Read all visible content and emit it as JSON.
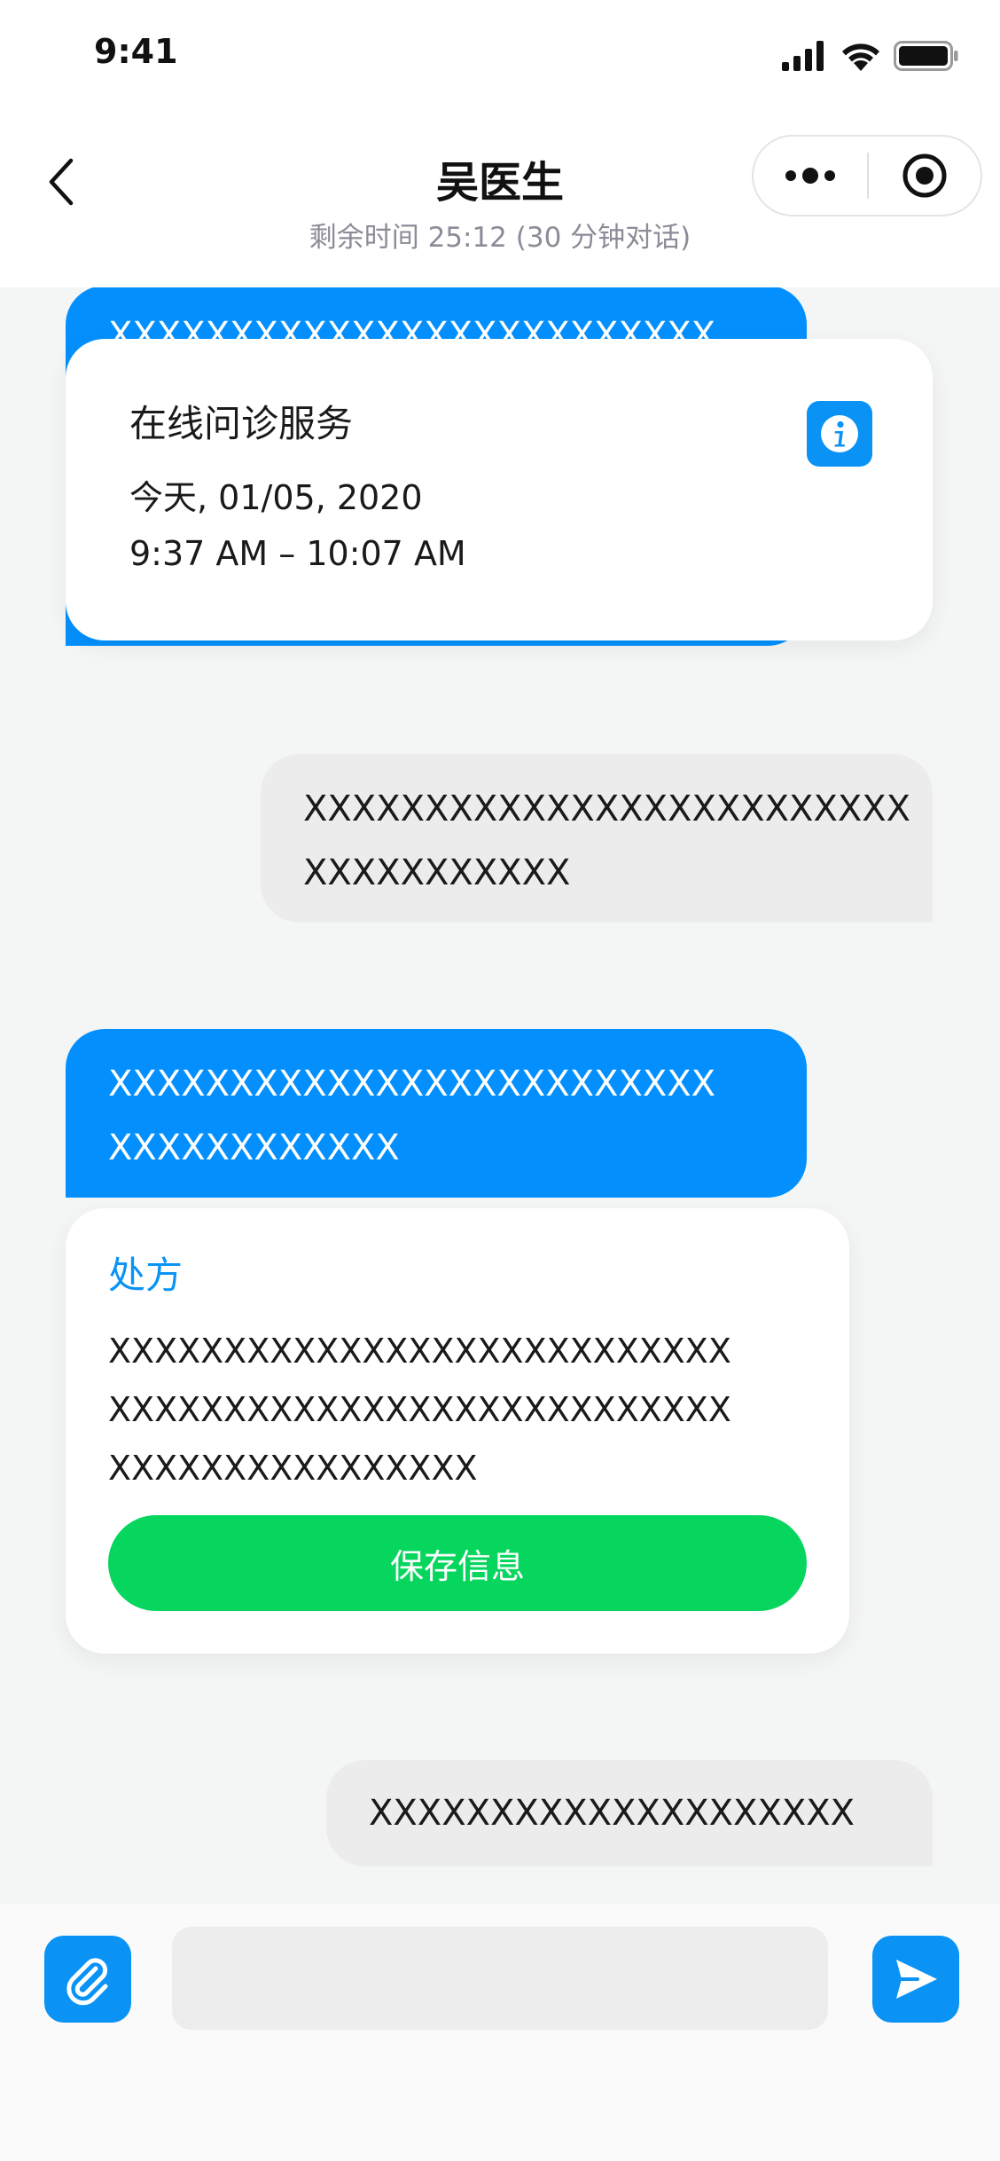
{
  "status_bar": {
    "time": "9:41"
  },
  "header": {
    "title": "吴医生",
    "subtitle": "剩余时间 25:12 (30 分钟对话)"
  },
  "messages": {
    "doctor_msg_1": "XXXXXXXXXXXXXXXXXXXXXXXXX",
    "consult_card": {
      "title": "在线问诊服务",
      "date": "今天, 01/05, 2020",
      "time_range": "9:37 AM – 10:07 AM"
    },
    "user_msg_1": {
      "line1": "XXXXXXXXXXXXXXXXXXXXXXXXX",
      "line2": "XXXXXXXXXXX"
    },
    "doctor_msg_2": {
      "line1": "XXXXXXXXXXXXXXXXXXXXXXXXX",
      "line2": "XXXXXXXXXXXX"
    },
    "prescription": {
      "title": "处方",
      "body": "XXXXXXXXXXXXXXXXXXXXXXXXXXXXXXXXXXXXXXXXXXXXXXXXXXXXXXXXXXXXXXXXXXXXXX",
      "save_label": "保存信息"
    },
    "user_msg_2": "XXXXXXXXXXXXXXXXXXXX"
  },
  "input_bar": {
    "placeholder": ""
  },
  "icons": {
    "back": "chevron-left-icon",
    "more": "more-dots-icon",
    "close": "target-circle-icon",
    "info": "info-icon",
    "attach": "paperclip-icon",
    "send": "send-arrow-icon"
  },
  "colors": {
    "primary_blue": "#0390fe",
    "accent_blue": "#0a93f5",
    "save_green": "#06d65e",
    "chat_background": "#f4f5f5",
    "user_bubble": "#ececec"
  }
}
